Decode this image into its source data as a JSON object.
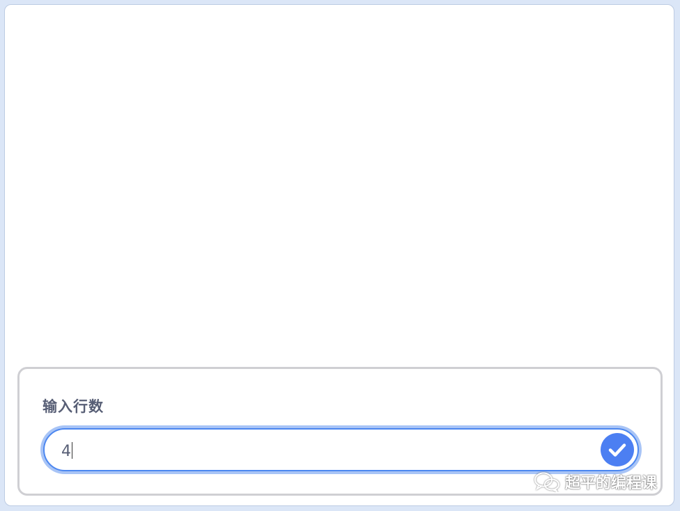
{
  "ask": {
    "question": "输入行数",
    "answer_value": "4"
  },
  "icons": {
    "submit": "checkmark-icon",
    "watermark": "wechat-icon"
  },
  "watermark": {
    "text": "超平的编程课"
  },
  "colors": {
    "page_background": "#dbe6f7",
    "stage_background": "#ffffff",
    "panel_border": "#cfcfd3",
    "question_text": "#575e75",
    "input_focus_border": "#4c87f0",
    "input_focus_glow": "#a8c4f6",
    "submit_button": "#4c7ff2"
  }
}
